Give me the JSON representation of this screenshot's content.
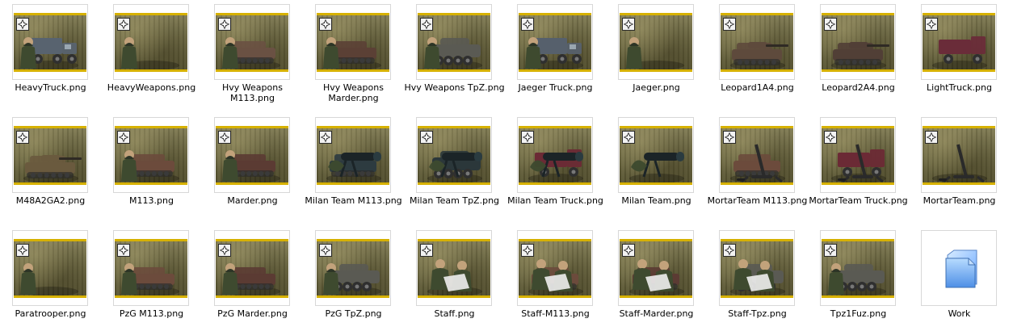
{
  "files": [
    {
      "name": "HeavyTruck.png",
      "subject": "truck",
      "tone": "#58636f"
    },
    {
      "name": "HeavyWeapons.png",
      "subject": "soldier",
      "tone": "#3f4a2f"
    },
    {
      "name": "Hvy Weapons M113.png",
      "subject": "apc",
      "tone": "#6a5143"
    },
    {
      "name": "Hvy Weapons Marder.png",
      "subject": "apc",
      "tone": "#5b4035"
    },
    {
      "name": "Hvy Weapons TpZ.png",
      "subject": "wheeled",
      "tone": "#5a5a53"
    },
    {
      "name": "Jaeger Truck.png",
      "subject": "truck",
      "tone": "#56606c"
    },
    {
      "name": "Jaeger.png",
      "subject": "soldier",
      "tone": "#4a5538"
    },
    {
      "name": "Leopard1A4.png",
      "subject": "tank",
      "tone": "#5e4a3c"
    },
    {
      "name": "Leopard2A4.png",
      "subject": "tank",
      "tone": "#513f36"
    },
    {
      "name": "LightTruck.png",
      "subject": "lighttruck",
      "tone": "#6a2c39"
    },
    {
      "name": "M48A2GA2.png",
      "subject": "tank",
      "tone": "#6a5a3e"
    },
    {
      "name": "M113.png",
      "subject": "apc",
      "tone": "#6c4b3c"
    },
    {
      "name": "Marder.png",
      "subject": "apc",
      "tone": "#5b3b33"
    },
    {
      "name": "Milan Team M113.png",
      "subject": "milanapc",
      "tone": "#2d3b40"
    },
    {
      "name": "Milan Team TpZ.png",
      "subject": "milanwheeled",
      "tone": "#2b373a"
    },
    {
      "name": "Milan Team Truck.png",
      "subject": "milantruck",
      "tone": "#6b2a35"
    },
    {
      "name": "Milan Team.png",
      "subject": "milan",
      "tone": "#243036"
    },
    {
      "name": "MortarTeam M113.png",
      "subject": "mortarapc",
      "tone": "#6c4b3c"
    },
    {
      "name": "MortarTeam Truck.png",
      "subject": "mortartruck",
      "tone": "#6b2a35"
    },
    {
      "name": "MortarTeam.png",
      "subject": "mortar",
      "tone": "#3a3a2f"
    },
    {
      "name": "Paratrooper.png",
      "subject": "soldier",
      "tone": "#4a5538"
    },
    {
      "name": "PzG M113.png",
      "subject": "apc",
      "tone": "#6c4b3c"
    },
    {
      "name": "PzG Marder.png",
      "subject": "apc",
      "tone": "#5b3b33"
    },
    {
      "name": "PzG TpZ.png",
      "subject": "wheeled",
      "tone": "#5a5a53"
    },
    {
      "name": "Staff.png",
      "subject": "staff",
      "tone": "#4b5332"
    },
    {
      "name": "Staff-M113.png",
      "subject": "staffapc",
      "tone": "#6c4b3c"
    },
    {
      "name": "Staff-Marder.png",
      "subject": "staffapc",
      "tone": "#5b3b33"
    },
    {
      "name": "Staff-Tpz.png",
      "subject": "staffwheeled",
      "tone": "#5a5a53"
    },
    {
      "name": "Tpz1Fuz.png",
      "subject": "wheeled",
      "tone": "#5a5a53"
    },
    {
      "name": "Work",
      "subject": "folder",
      "tone": "#7fb2ff"
    }
  ],
  "icons": {
    "cross": "iron-cross-icon",
    "folder": "folder-icon"
  }
}
